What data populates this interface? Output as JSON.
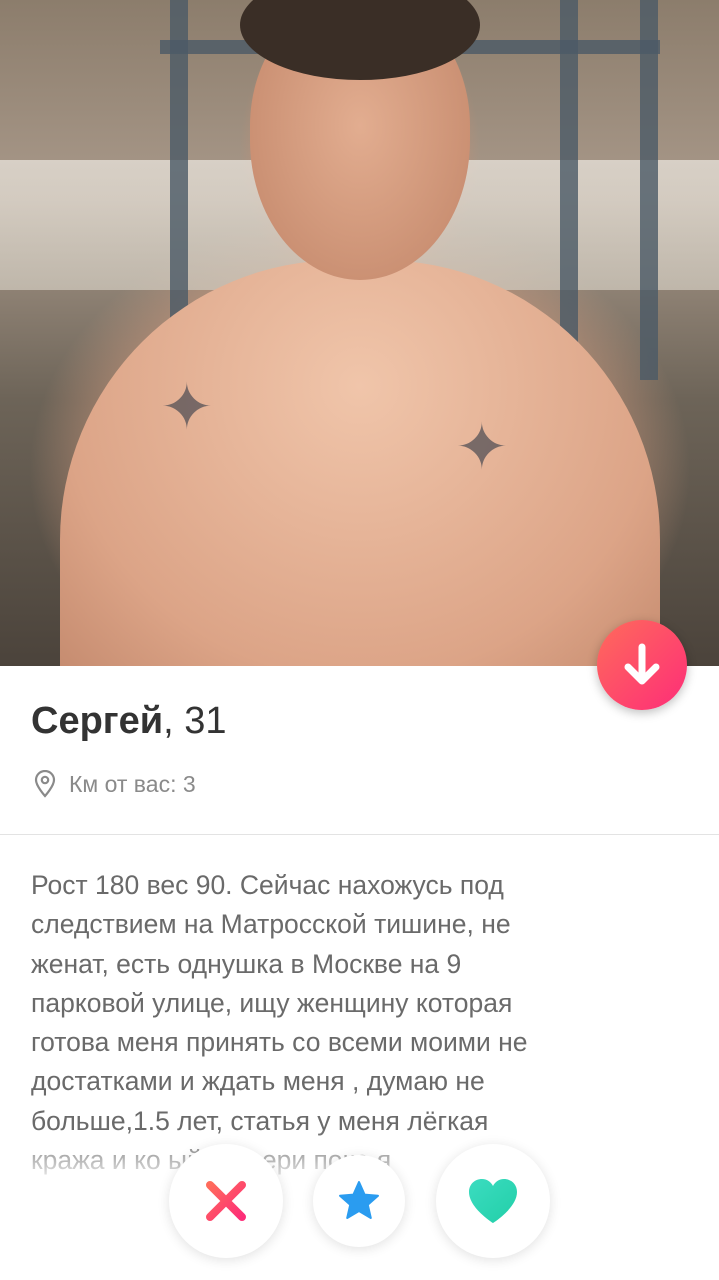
{
  "profile": {
    "name": "Сергей",
    "separator": ", ",
    "age": "31",
    "distance": "Км от вас: 3",
    "bio": "Рост 180 вес 90.  Сейчас  нахожусь под\nследствием на Матросской тишине,  не\nженат,  есть однушка в Москве на 9\nпарковой улице,  ищу женщину которая\nготова меня принять со всеми моими не\nдостатками и ждать меня ,  думаю не\nбольше,1.5 лет,  статья у меня лёгкая\nкража и ко   ый см    вери     пока я"
  },
  "actions": {
    "nope_icon": "close-icon",
    "super_like_icon": "star-icon",
    "like_icon": "heart-icon",
    "collapse_icon": "arrow-down-icon"
  },
  "colors": {
    "nope": "#fd4f68",
    "star": "#2a9cf0",
    "like": "#2ad8b4",
    "collapse_gradient_start": "#ff6b5b",
    "collapse_gradient_end": "#fd2d78"
  }
}
